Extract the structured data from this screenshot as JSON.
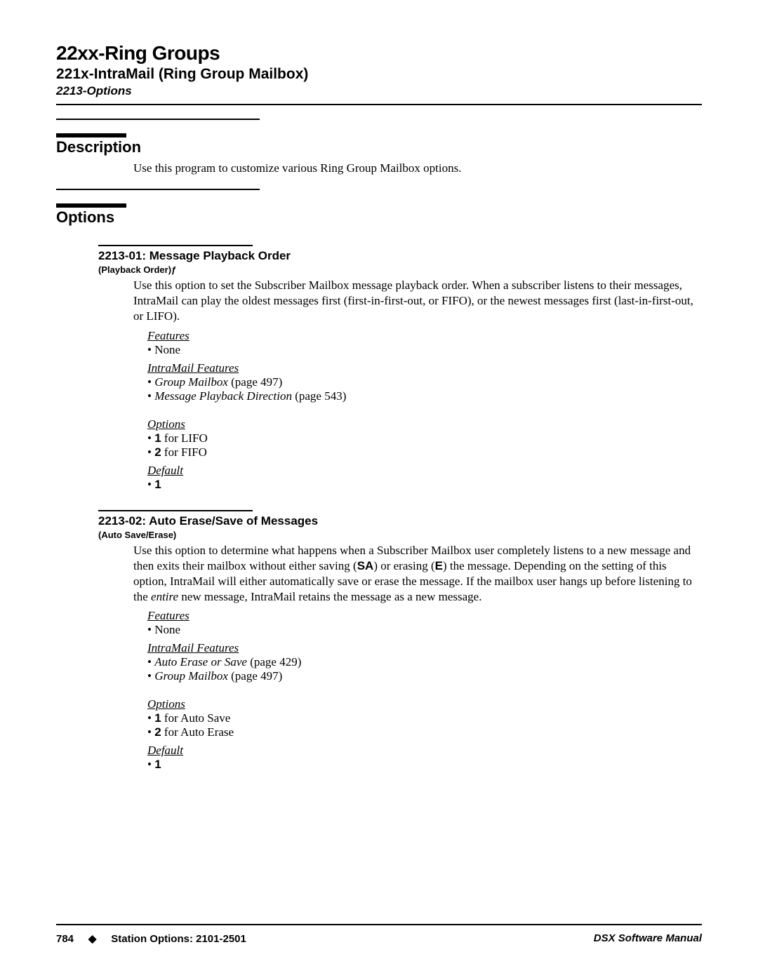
{
  "header": {
    "title": "22xx-Ring Groups",
    "subtitle": "221x-IntraMail (Ring Group Mailbox)",
    "option_line": "2213-Options"
  },
  "sections": {
    "description": {
      "heading": "Description",
      "text": "Use this program to customize various Ring Group Mailbox options."
    },
    "options_heading": "Options"
  },
  "opt1": {
    "title": "2213-01: Message Playback Order",
    "subtitle": "(Playback Order)ƒ",
    "para": "Use this option to set the Subscriber Mailbox message playback order. When a subscriber listens to their messages, IntraMail can play the oldest messages first (first-in-first-out, or FIFO), or the newest messages first (last-in-first-out, or LIFO).",
    "features_label": "Features",
    "features_none": "None",
    "intramail_label": "IntraMail Features",
    "im1_name": "Group Mailbox",
    "im1_page": " (page 497)",
    "im2_name": "Message Playback Direction",
    "im2_page": " (page 543)",
    "options_label": "Options",
    "o1_bold": "1",
    "o1_rest": " for LIFO",
    "o2_bold": "2",
    "o2_rest": " for FIFO",
    "default_label": "Default",
    "default_val": "1"
  },
  "opt2": {
    "title": "2213-02: Auto Erase/Save of Messages",
    "subtitle": "(Auto Save/Erase)",
    "para_pre1": "Use this option to determine what happens when a Subscriber Mailbox user completely listens to a new message and then exits their mailbox without either saving (",
    "para_sa": "SA",
    "para_mid1": ") or erasing (",
    "para_e": "E",
    "para_mid2": ") the message. Depending on the setting of this option, IntraMail will either automatically save or erase the message. If the mailbox user hangs up before listening to the ",
    "para_entire": "entire",
    "para_post": " new message, IntraMail retains the message as a new message.",
    "features_label": "Features",
    "features_none": "None",
    "intramail_label": "IntraMail Features",
    "im1_name": "Auto Erase or Save",
    "im1_page": " (page 429)",
    "im2_name": "Group Mailbox",
    "im2_page": " (page 497)",
    "options_label": "Options",
    "o1_bold": "1",
    "o1_rest": " for Auto Save",
    "o2_bold": "2",
    "o2_rest": " for Auto Erase",
    "default_label": "Default",
    "default_val": "1"
  },
  "footer": {
    "page_num": "784",
    "diamond": "◆",
    "left_text": "Station Options: 2101-2501",
    "right_text": "DSX Software Manual"
  }
}
